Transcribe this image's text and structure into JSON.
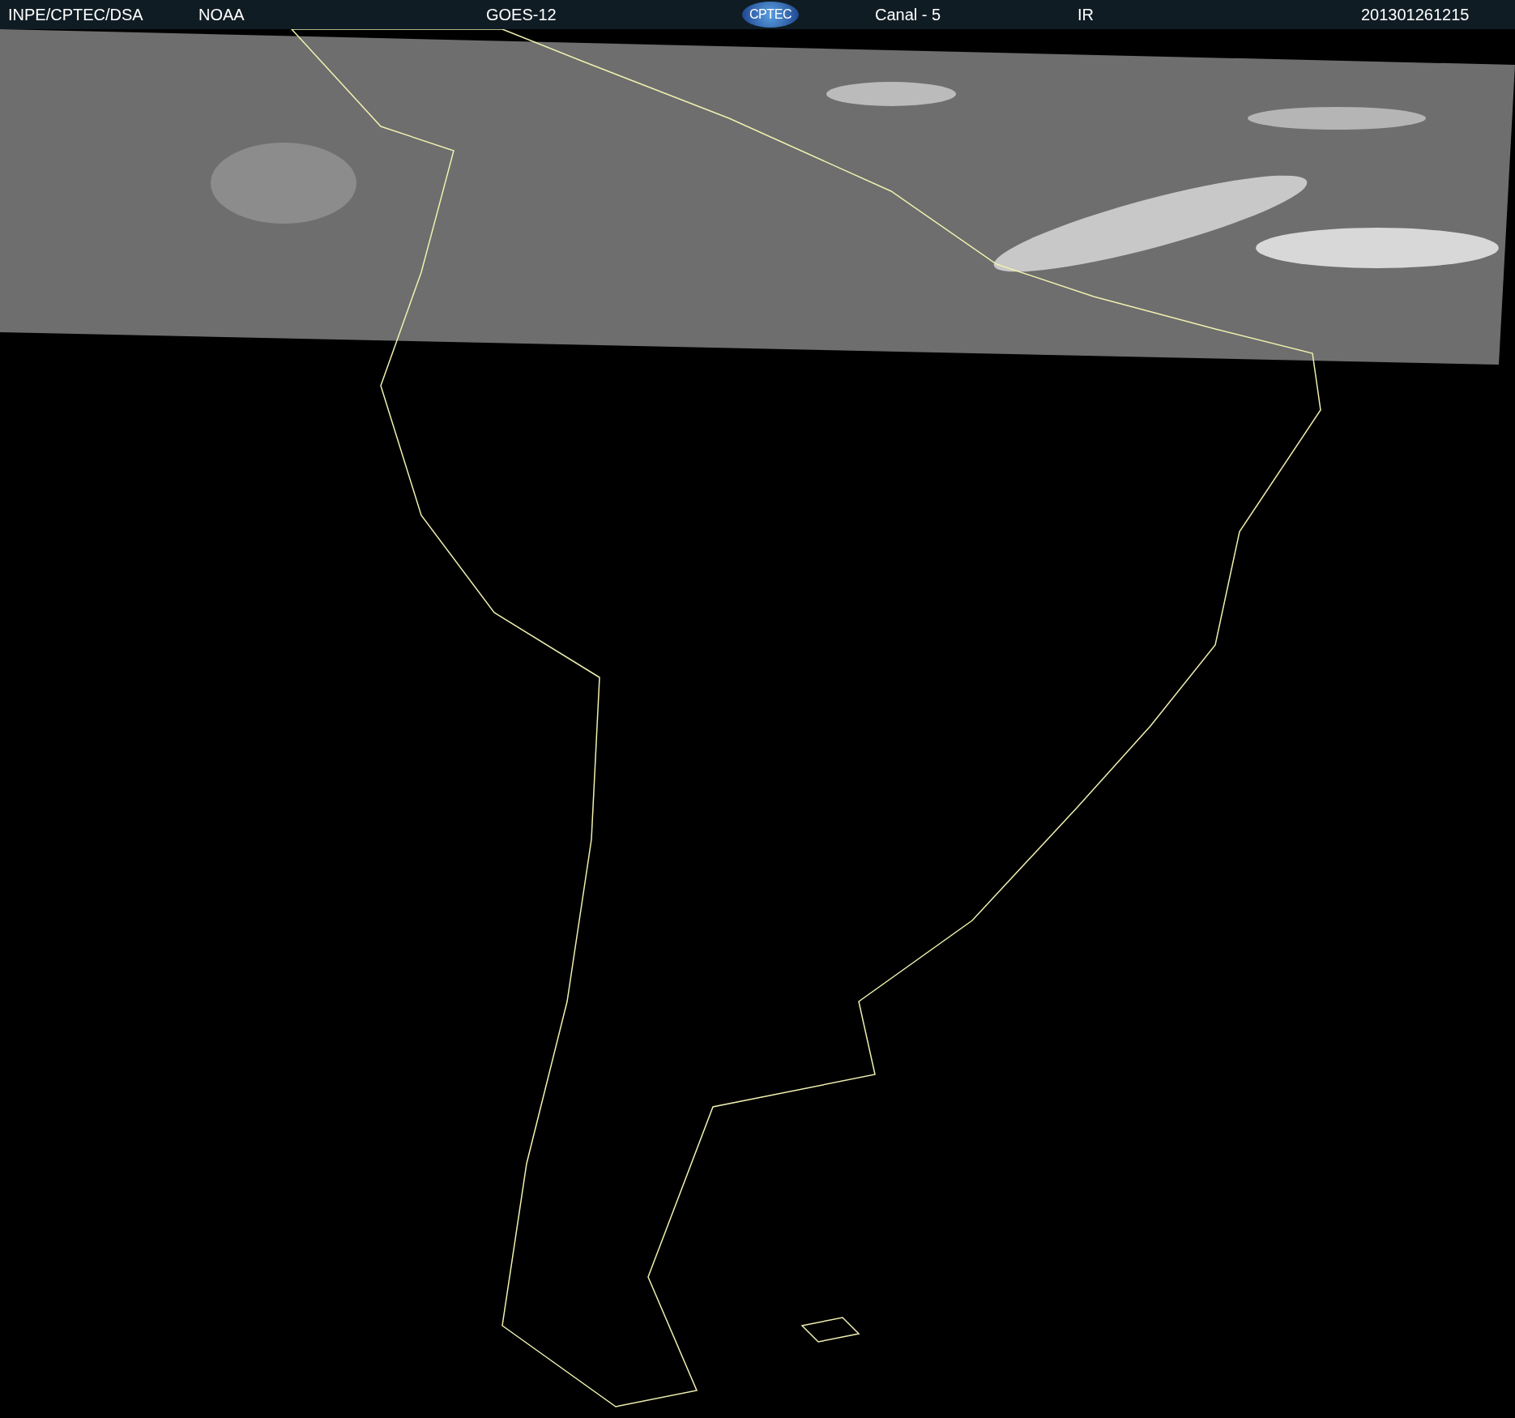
{
  "header": {
    "items": [
      {
        "kind": "text",
        "text": "INPE/CPTEC/DSA"
      },
      {
        "kind": "text",
        "text": "NOAA"
      },
      {
        "kind": "text",
        "text": "GOES-12"
      },
      {
        "kind": "logo",
        "text": "CPTEC"
      },
      {
        "kind": "text",
        "text": "Canal - 5"
      },
      {
        "kind": "text",
        "text": "IR"
      },
      {
        "kind": "text",
        "text": "201301261215"
      }
    ]
  }
}
